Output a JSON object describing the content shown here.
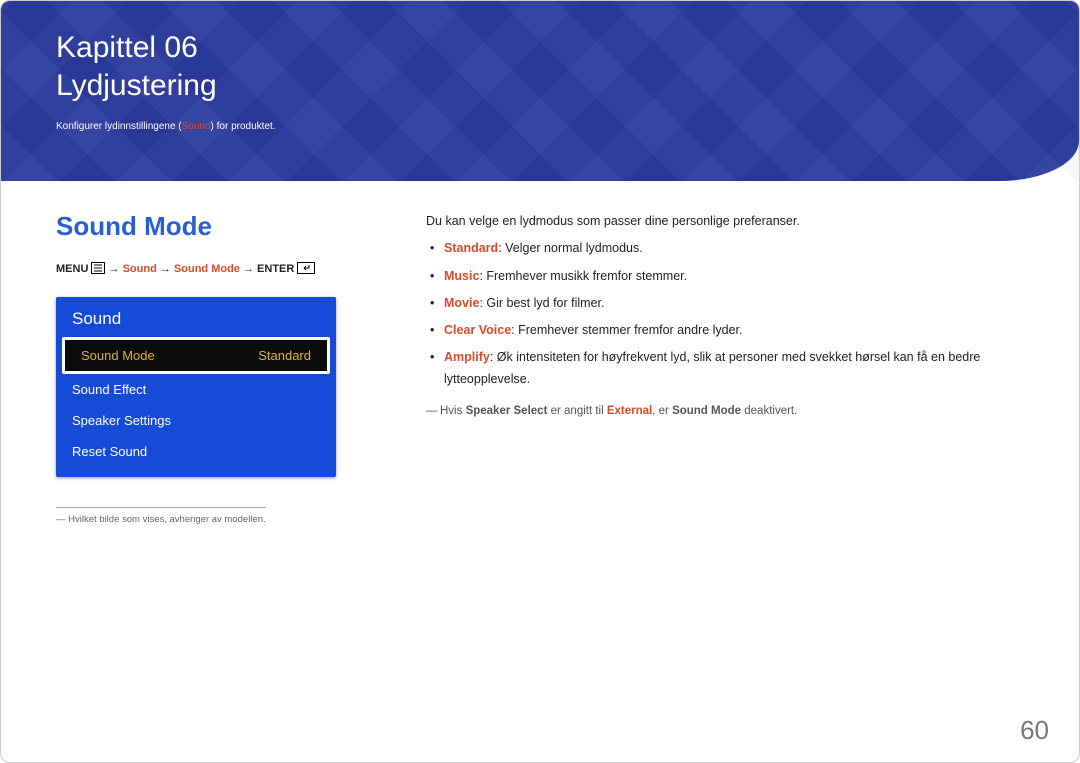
{
  "banner": {
    "chapter": "Kapittel 06",
    "title": "Lydjustering",
    "subtitle_pre": "Konfigurer lydinnstillingene (",
    "subtitle_highlight": "Sound",
    "subtitle_post": ") for produktet."
  },
  "left": {
    "section_title": "Sound Mode",
    "menupath": {
      "menu": "MENU ",
      "arrow1": " → ",
      "s1": "Sound",
      "arrow2": " → ",
      "s2": "Sound Mode",
      "arrow3": " → ",
      "enter": "ENTER "
    },
    "osd": {
      "title": "Sound",
      "selected_label": "Sound Mode",
      "selected_value": "Standard",
      "items": [
        "Sound Effect",
        "Speaker Settings",
        "Reset Sound"
      ]
    },
    "footnote": "―  Hvilket bilde som vises, avhenger av modellen."
  },
  "right": {
    "intro": "Du kan velge en lydmodus som passer dine personlige preferanser.",
    "bullets": [
      {
        "term": "Standard",
        "desc": ": Velger normal lydmodus."
      },
      {
        "term": "Music",
        "desc": ": Fremhever musikk fremfor stemmer."
      },
      {
        "term": "Movie",
        "desc": ": Gir best lyd for filmer."
      },
      {
        "term": "Clear Voice",
        "desc": ": Fremhever stemmer fremfor andre lyder."
      },
      {
        "term": "Amplify",
        "desc": ": Øk intensiteten for høyfrekvent lyd, slik at personer med svekket hørsel kan få en bedre lytteopplevelse."
      }
    ],
    "note": {
      "pre": "Hvis ",
      "b1": "Speaker Select",
      "mid1": " er angitt til ",
      "r1": "External",
      "mid2": ", er ",
      "b2": "Sound Mode",
      "post": " deaktivert."
    }
  },
  "page_number": "60"
}
